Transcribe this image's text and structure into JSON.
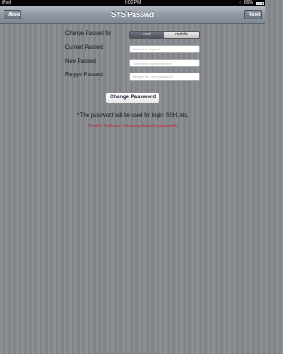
{
  "status_bar": {
    "carrier": "iPod",
    "time": "9:02 PM",
    "battery": "89%"
  },
  "nav": {
    "title": "SYS Passwd",
    "left_button": "About",
    "right_button": "Reset"
  },
  "form": {
    "user_label": "Change Passwd for",
    "user_options": [
      "root",
      "mobile"
    ],
    "selected_user": "root",
    "current_label": "Current Passwd",
    "current_placeholder": "Default is \"alpine\"",
    "new_label": "New Passwd",
    "new_placeholder": "Type new password here",
    "retype_label": "Retype Passwd",
    "retype_placeholder": "Retype the new password"
  },
  "change_button": "Change Password",
  "notes": {
    "info": "* The password will be used for login, SSH, etc.",
    "warning": "(Hard to fall back to factory default password!)"
  },
  "colors": {
    "warning": "#d81b1b",
    "background": "#85888d"
  }
}
